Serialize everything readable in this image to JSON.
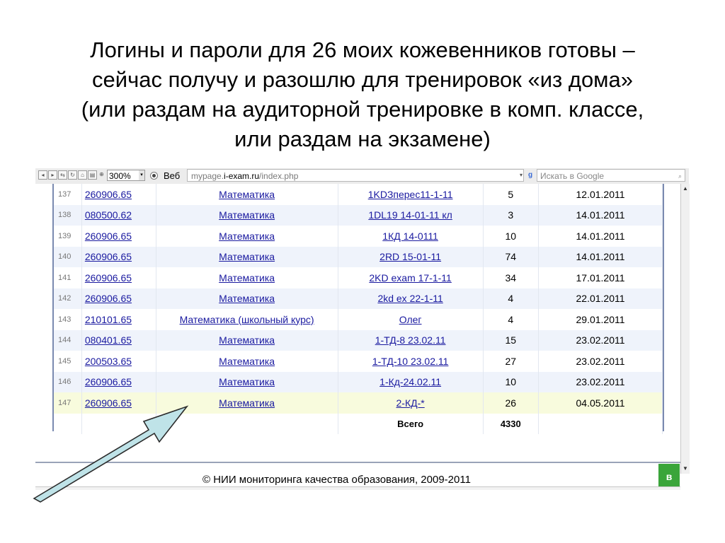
{
  "slide": {
    "title_lines": [
      "Логины и пароли для 26 моих кожевенников готовы –",
      "сейчас получу и разошлю для тренировок «из дома»",
      "(или раздам на аудиторной тренировке в комп. классе,",
      "или раздам на экзамене)"
    ]
  },
  "browser": {
    "zoom": "300%",
    "search_engine_label": "Веб",
    "url_domain_prefix": "mypage.",
    "url_domain": "i-exam.ru",
    "url_path": "/index.php",
    "search_placeholder": "Искать в Google"
  },
  "table": {
    "rows": [
      {
        "num": "137",
        "code": "260906.65",
        "subject": "Математика",
        "login": "1KDЗперес11-1-11",
        "count": "5",
        "date": "12.01.2011"
      },
      {
        "num": "138",
        "code": "080500.62",
        "subject": "Математика",
        "login": "1DL19 14-01-11 кл",
        "count": "3",
        "date": "14.01.2011"
      },
      {
        "num": "139",
        "code": "260906.65",
        "subject": "Математика",
        "login": "1КД 14-0111",
        "count": "10",
        "date": "14.01.2011"
      },
      {
        "num": "140",
        "code": "260906.65",
        "subject": "Математика",
        "login": "2RD 15-01-11",
        "count": "74",
        "date": "14.01.2011"
      },
      {
        "num": "141",
        "code": "260906.65",
        "subject": "Математика",
        "login": "2KD exam 17-1-11",
        "count": "34",
        "date": "17.01.2011"
      },
      {
        "num": "142",
        "code": "260906.65",
        "subject": "Математика",
        "login": "2kd ex 22-1-11",
        "count": "4",
        "date": "22.01.2011"
      },
      {
        "num": "143",
        "code": "210101.65",
        "subject": "Математика (школьный курс)",
        "login": "Олег",
        "count": "4",
        "date": "29.01.2011"
      },
      {
        "num": "144",
        "code": "080401.65",
        "subject": "Математика",
        "login": "1-ТД-8 23.02.11",
        "count": "15",
        "date": "23.02.2011"
      },
      {
        "num": "145",
        "code": "200503.65",
        "subject": "Математика",
        "login": "1-ТД-10 23.02.11",
        "count": "27",
        "date": "23.02.2011"
      },
      {
        "num": "146",
        "code": "260906.65",
        "subject": "Математика",
        "login": "1-Кд-24.02.11",
        "count": "10",
        "date": "23.02.2011"
      },
      {
        "num": "147",
        "code": "260906.65",
        "subject": "Математика",
        "login": "2-КД-*",
        "count": "26",
        "date": "04.05.2011"
      }
    ],
    "total_label": "Всего",
    "total_value": "4330"
  },
  "footer": {
    "copyright": "© НИИ мониторинга качества образования, 2009-2011",
    "side_tab": "в"
  },
  "colors": {
    "link": "#1a1aa0",
    "row_alt": "#eff3fb",
    "row_highlight": "#f8fbdd",
    "arrow_fill": "#bfe3e8",
    "side_tab": "#3aa53a"
  }
}
